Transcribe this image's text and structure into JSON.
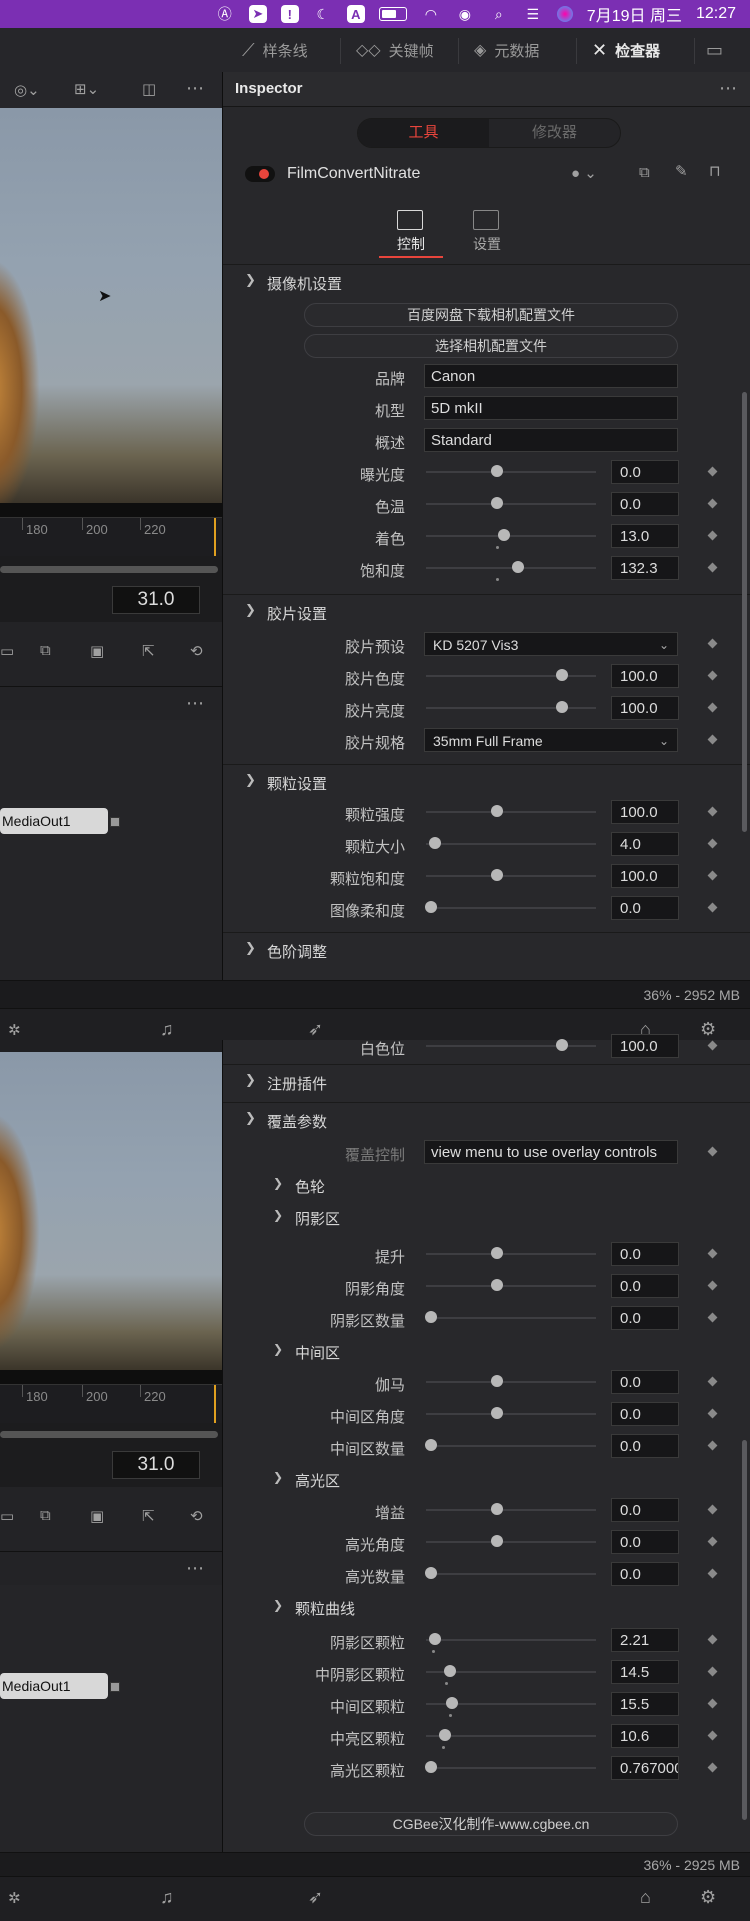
{
  "menubar": {
    "date": "7月19日 周三",
    "time": "12:27",
    "icons": [
      "a-circle-icon",
      "arrow-box-icon",
      "exclamation-box-icon",
      "moon-icon",
      "a-box-icon",
      "battery-icon",
      "wifi-icon",
      "user-icon",
      "search-icon",
      "control-center-icon",
      "siri-icon"
    ]
  },
  "toolbar": {
    "spline": "样条线",
    "keyframes": "关键帧",
    "metadata": "元数据",
    "inspector": "检查器"
  },
  "viewer": {
    "ruler_ticks": [
      "180",
      "200",
      "220"
    ],
    "timecode": "31.0",
    "node": "MediaOut1"
  },
  "inspector": {
    "title": "Inspector",
    "tab_tools": "工具",
    "tab_modifiers": "修改器",
    "plugin_name": "FilmConvertNitrate",
    "subtab_controls": "控制",
    "subtab_settings": "设置",
    "camera": {
      "section": "摄像机设置",
      "btn_download": "百度网盘下载相机配置文件",
      "btn_select": "选择相机配置文件",
      "brand_label": "品牌",
      "brand_value": "Canon",
      "model_label": "机型",
      "model_value": "5D mkII",
      "profile_label": "概述",
      "profile_value": "Standard",
      "exposure_label": "曝光度",
      "exposure_value": "0.0",
      "temp_label": "色温",
      "temp_value": "0.0",
      "tint_label": "着色",
      "tint_value": "13.0",
      "sat_label": "饱和度",
      "sat_value": "132.3"
    },
    "film": {
      "section": "胶片设置",
      "preset_label": "胶片预设",
      "preset_value": "KD 5207 Vis3",
      "color_label": "胶片色度",
      "color_value": "100.0",
      "luma_label": "胶片亮度",
      "luma_value": "100.0",
      "format_label": "胶片规格",
      "format_value": "35mm Full Frame"
    },
    "grain": {
      "section": "颗粒设置",
      "strength_label": "颗粒强度",
      "strength_value": "100.0",
      "size_label": "颗粒大小",
      "size_value": "4.0",
      "sat_label": "颗粒饱和度",
      "sat_value": "100.0",
      "soft_label": "图像柔和度",
      "soft_value": "0.0"
    },
    "levels_section": "色阶调整",
    "status1": "36% - 2952 MB"
  },
  "inspector2": {
    "white_label": "白色位",
    "white_value": "100.0",
    "register_section": "注册插件",
    "overlay_section": "覆盖参数",
    "overlay_ctrl_label": "覆盖控制",
    "overlay_ctrl_value": "view menu to use overlay controls",
    "colorwheel": "色轮",
    "shadows": "阴影区",
    "lift_label": "提升",
    "lift_value": "0.0",
    "shadow_angle_label": "阴影角度",
    "shadow_angle_value": "0.0",
    "shadow_amt_label": "阴影区数量",
    "shadow_amt_value": "0.0",
    "midtones": "中间区",
    "gamma_label": "伽马",
    "gamma_value": "0.0",
    "mid_angle_label": "中间区角度",
    "mid_angle_value": "0.0",
    "mid_amt_label": "中间区数量",
    "mid_amt_value": "0.0",
    "highlights": "高光区",
    "gain_label": "增益",
    "gain_value": "0.0",
    "hi_angle_label": "高光角度",
    "hi_angle_value": "0.0",
    "hi_amt_label": "高光数量",
    "hi_amt_value": "0.0",
    "grain_curve": "颗粒曲线",
    "gc_shadow_label": "阴影区颗粒",
    "gc_shadow_value": "2.21",
    "gc_midshadow_label": "中阴影区颗粒",
    "gc_midshadow_value": "14.5",
    "gc_mid_label": "中间区颗粒",
    "gc_mid_value": "15.5",
    "gc_midhi_label": "中亮区颗粒",
    "gc_midhi_value": "10.6",
    "gc_hi_label": "高光区颗粒",
    "gc_hi_value": "0.767000",
    "credit_button": "CGBee汉化制作-www.cgbee.cn",
    "status2": "36% - 2925 MB"
  }
}
